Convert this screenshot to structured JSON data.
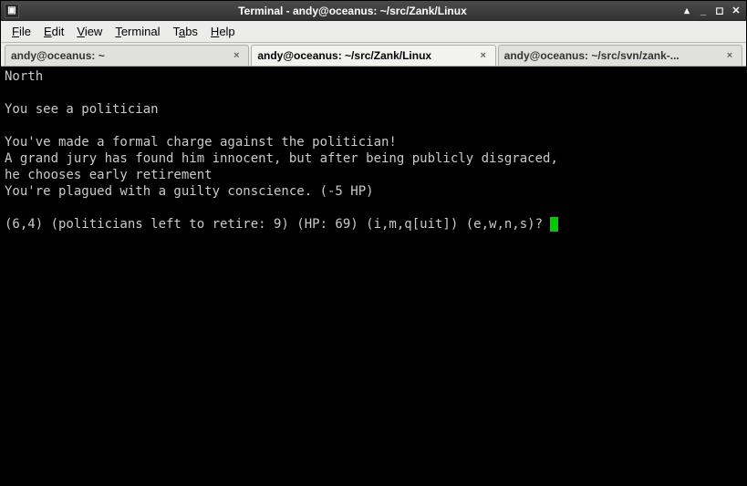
{
  "window": {
    "title": "Terminal - andy@oceanus: ~/src/Zank/Linux"
  },
  "menubar": {
    "items": [
      {
        "label": "File",
        "accel": "F"
      },
      {
        "label": "Edit",
        "accel": "E"
      },
      {
        "label": "View",
        "accel": "V"
      },
      {
        "label": "Terminal",
        "accel": "T"
      },
      {
        "label": "Tabs",
        "accel": "a"
      },
      {
        "label": "Help",
        "accel": "H"
      }
    ]
  },
  "tabs": [
    {
      "label": "andy@oceanus: ~",
      "active": false
    },
    {
      "label": "andy@oceanus: ~/src/Zank/Linux",
      "active": true
    },
    {
      "label": "andy@oceanus: ~/src/svn/zank-...",
      "active": false
    }
  ],
  "terminal": {
    "lines": [
      "North",
      "",
      "You see a politician",
      "",
      "You've made a formal charge against the politician!",
      "A grand jury has found him innocent, but after being publicly disgraced,",
      "he chooses early retirement",
      "You're plagued with a guilty conscience. (-5 HP)",
      "",
      "(6,4) (politicians left to retire: 9) (HP: 69) (i,m,q[uit]) (e,w,n,s)? "
    ]
  }
}
